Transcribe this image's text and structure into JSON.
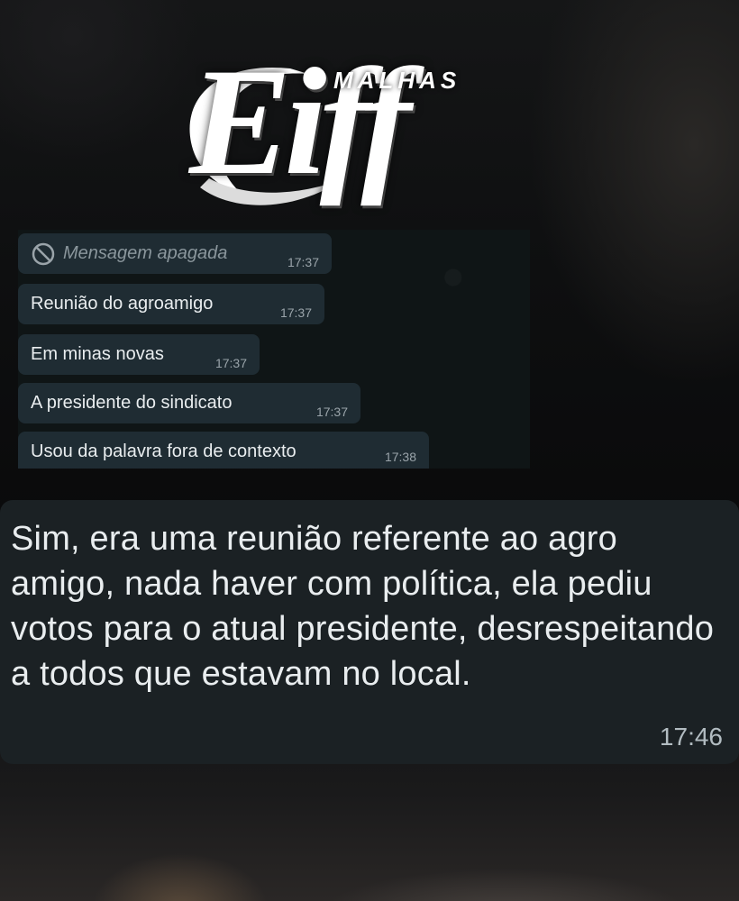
{
  "logo": {
    "small_text": "MALHAS",
    "big_text": "Eiff"
  },
  "chat": {
    "messages": [
      {
        "text": "Mensagem apagada",
        "time": "17:37",
        "deleted": true,
        "icon": "ban-icon"
      },
      {
        "text": "Reunião do agroamigo",
        "time": "17:37"
      },
      {
        "text": "Em minas novas",
        "time": "17:37"
      },
      {
        "text": "A presidente do sindicato",
        "time": "17:37"
      },
      {
        "text": "Usou da palavra fora de contexto",
        "time": "17:38"
      }
    ]
  },
  "reply": {
    "text": "Sim, era uma reunião referente ao agro amigo, nada haver com política, ela pediu votos para o atual presidente, desrespeitando a todos que estavam no local.",
    "time": "17:46"
  },
  "colors": {
    "bubble": "#1f2c33",
    "big_bubble": "#1b2124",
    "text": "#e9edef",
    "time": "#9aa4aa"
  }
}
